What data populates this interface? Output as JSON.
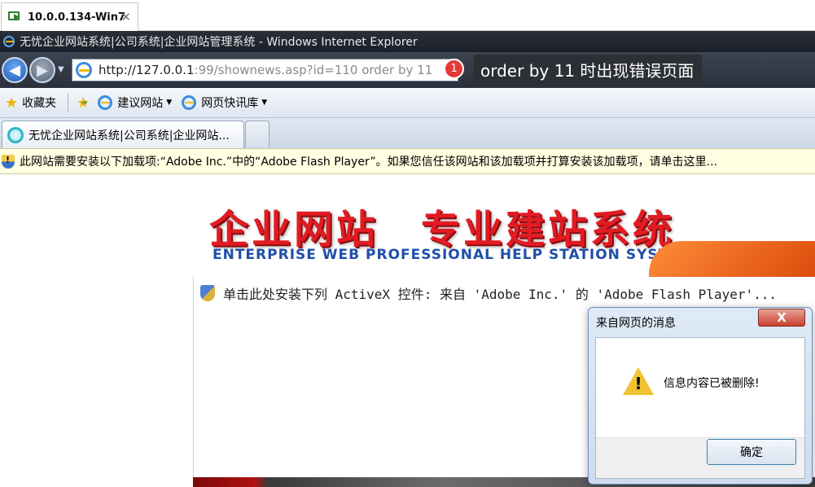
{
  "vm_tab": {
    "title": "10.0.0.134-Win7",
    "close": "✕"
  },
  "window": {
    "title": "无忧企业网站系统|公司系统|企业网站管理系统 - Windows Internet Explorer"
  },
  "address_bar": {
    "url_host": "http://127.0.0.1",
    "url_path": ":99/shownews.asp?id=110 order by 11"
  },
  "annotation": {
    "badge": "1",
    "text": "order by 11 时出现错误页面"
  },
  "favorites_bar": {
    "favorites_label": "收藏夹",
    "items": [
      {
        "label": "建议网站",
        "icon": "ie-icon"
      },
      {
        "label": "网页快讯库",
        "icon": "ie-icon"
      }
    ]
  },
  "tabs": [
    {
      "label": "无忧企业网站系统|公司系统|企业网站..."
    }
  ],
  "info_bar": {
    "text": "此网站需要安装以下加载项:“Adobe Inc.”中的“Adobe Flash Player”。如果您信任该网站和该加载项并打算安装该加载项，请单击这里..."
  },
  "page": {
    "banner_title": "企业网站　专业建站系统",
    "banner_subtitle": "ENTERPRISE WEB PROFESSIONAL HELP STATION SYSTEM",
    "activex_prompt": "单击此处安装下列 ActiveX 控件: 来自 'Adobe Inc.' 的 'Adobe Flash Player'..."
  },
  "dialog": {
    "title": "来自网页的消息",
    "close": "X",
    "message": "信息内容已被删除!",
    "ok_label": "确定"
  }
}
